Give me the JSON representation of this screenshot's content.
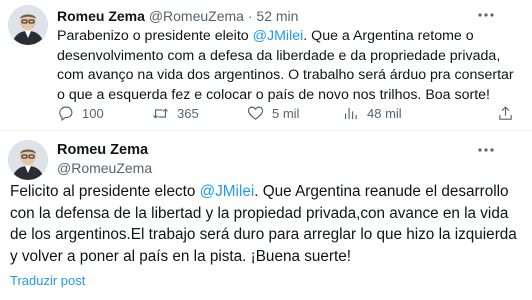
{
  "tweet": {
    "author_name": "Romeu Zema",
    "handle": "@RomeuZema",
    "separator": "·",
    "time": "52 min",
    "body_before": "Parabenizo o presidente eleito ",
    "mention": "@JMilei",
    "body_after": ". Que a Argentina retome o desenvolvimento com a defesa da liberdade e da propriedade privada, com avanço na vida dos argentinos. O trabalho será árduo pra consertar o que a esquerda fez e colocar o país de novo nos trilhos. Boa sorte!",
    "actions": {
      "replies": "100",
      "retweets": "365",
      "likes": "5 mil",
      "views": "48 mil"
    }
  },
  "quoted": {
    "author_name": "Romeu Zema",
    "handle": "@RomeuZema",
    "body_before": "Felicito al presidente electo ",
    "mention": "@JMilei",
    "body_after": ". Que Argentina reanude el desarrollo con la defensa de la libertad y la propiedad privada,con avance en la vida de los argentinos.El trabajo será duro para arreglar lo que hizo la izquierda y volver a poner al país en la pista. ¡Buena suerte!",
    "translate_label": "Traduzir post"
  },
  "icons": {
    "more": "more-horizontal-icon",
    "reply": "reply-icon",
    "retweet": "retweet-icon",
    "like": "heart-icon",
    "views": "analytics-icon",
    "share": "share-icon"
  },
  "colors": {
    "link": "#1d9bf0",
    "muted": "#536471",
    "text": "#0f1419"
  }
}
